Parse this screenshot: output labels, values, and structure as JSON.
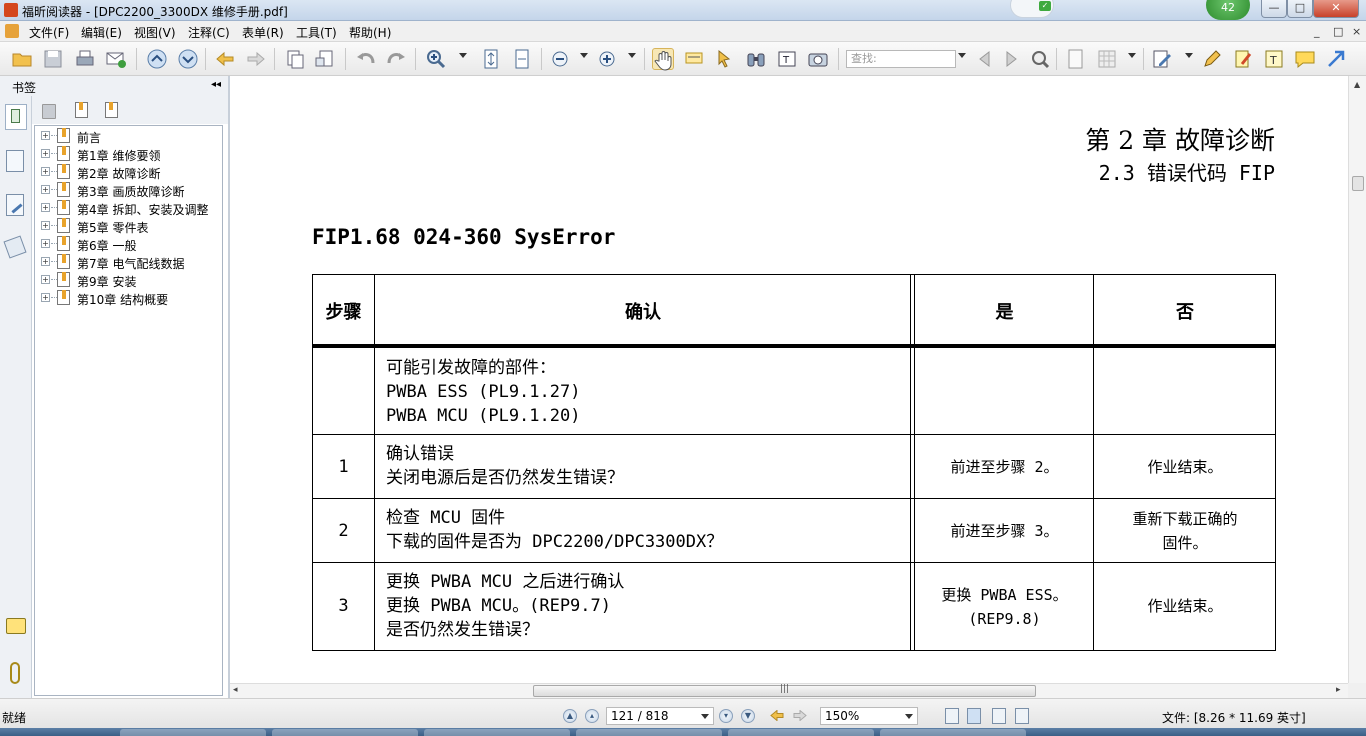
{
  "window": {
    "title": "福昕阅读器 - [DPC2200_3300DX 维修手册.pdf]",
    "notification_count": "42",
    "minimize": "—",
    "maximize": "□",
    "close": "✕"
  },
  "menu": {
    "items": [
      "文件(F)",
      "编辑(E)",
      "视图(V)",
      "注释(C)",
      "表单(R)",
      "工具(T)",
      "帮助(H)"
    ],
    "mdi_controls": [
      "_",
      "□",
      "×"
    ]
  },
  "toolbar": {
    "search_placeholder": "查找:"
  },
  "bookmarks": {
    "panel_title": "书签",
    "collapse_glyph": "◂◂",
    "items": [
      {
        "label": "前言"
      },
      {
        "label": "第1章 维修要领"
      },
      {
        "label": "第2章 故障诊断"
      },
      {
        "label": "第3章 画质故障诊断"
      },
      {
        "label": "第4章 拆卸、安装及调整"
      },
      {
        "label": "第5章 零件表"
      },
      {
        "label": "第6章 一般"
      },
      {
        "label": "第7章 电气配线数据"
      },
      {
        "label": "第9章 安装"
      },
      {
        "label": "第10章 结构概要"
      }
    ]
  },
  "document": {
    "chapter_title": "第 2 章   故障诊断",
    "section_title": "2.3   错误代码 FIP",
    "fip_heading": "FIP1.68   024-360 SysError",
    "table": {
      "headers": [
        "步骤",
        "确认",
        "是",
        "否"
      ],
      "rows": [
        {
          "step": "",
          "confirm": [
            "可能引发故障的部件：",
            "PWBA ESS (PL9.1.27)",
            "PWBA MCU (PL9.1.20)"
          ],
          "yes": [],
          "no": []
        },
        {
          "step": "1",
          "confirm": [
            "确认错误",
            "关闭电源后是否仍然发生错误？"
          ],
          "yes": [
            "前进至步骤 2。"
          ],
          "no": [
            "作业结束。"
          ]
        },
        {
          "step": "2",
          "confirm": [
            "检查 MCU 固件",
            "下载的固件是否为 DPC2200/DPC3300DX？"
          ],
          "yes": [
            "前进至步骤 3。"
          ],
          "no": [
            "重新下载正确的",
            "固件。"
          ]
        },
        {
          "step": "3",
          "confirm": [
            "更换 PWBA MCU 之后进行确认",
            "更换 PWBA MCU。(REP9.7)",
            "是否仍然发生错误？"
          ],
          "yes": [
            "更换 PWBA ESS。",
            "(REP9.8)"
          ],
          "no": [
            "作业结束。"
          ]
        }
      ]
    }
  },
  "statusbar": {
    "status": "就绪",
    "page": "121 / 818",
    "zoom": "150%",
    "file_size": "文件: [8.26 * 11.69 英寸]"
  }
}
